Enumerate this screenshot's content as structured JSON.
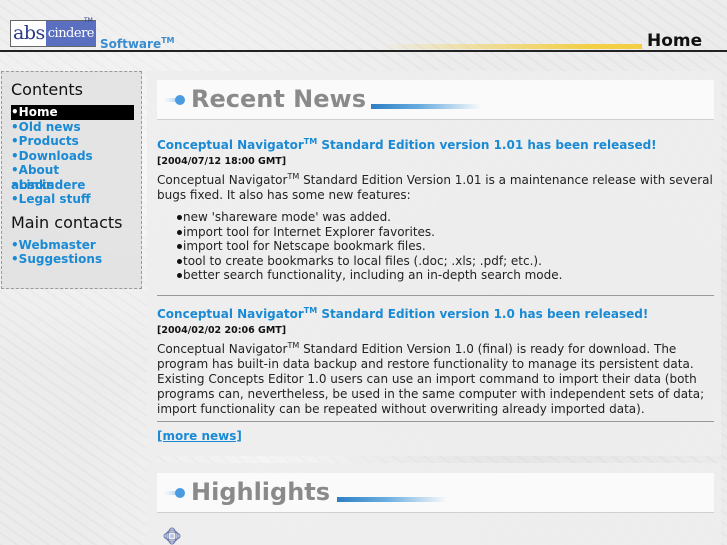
{
  "header": {
    "logo_abs": "abs",
    "logo_cindere": "cindere",
    "logo_tm": "TM",
    "software": "Software",
    "software_tm": "TM",
    "page_title": "Home"
  },
  "sidebar": {
    "contents_heading": "Contents",
    "items": [
      {
        "label": "•Home",
        "active": true
      },
      {
        "label": "•Old news"
      },
      {
        "label": "•Products"
      },
      {
        "label": "•Downloads"
      },
      {
        "label": "•About abscindere"
      },
      {
        "label": "•Links"
      },
      {
        "label": "•Legal stuff"
      }
    ],
    "contacts_heading": "Main contacts",
    "contacts": [
      {
        "label": "•Webmaster"
      },
      {
        "label": "•Suggestions"
      }
    ]
  },
  "recent_news": {
    "heading": "Recent News",
    "news": [
      {
        "title_pre": "Conceptual Navigator",
        "title_tm": "TM",
        "title_post": " Standard Edition version 1.01 has been released!",
        "date": "[2004/07/12 18:00 GMT]",
        "body_pre": "Conceptual Navigator",
        "body_tm": "TM",
        "body_post": " Standard Edition Version 1.01 is a maintenance release with several bugs fixed. It also has some new features:",
        "features": [
          "new 'shareware mode' was added.",
          "import tool for Internet Explorer favorites.",
          "import tool for Netscape bookmark files.",
          "tool to create bookmarks to local files (.doc; .xls; .pdf; etc.).",
          "better search functionality, including an in-depth search mode."
        ]
      },
      {
        "title_pre": "Conceptual Navigator",
        "title_tm": "TM",
        "title_post": " Standard Edition version 1.0 has been released!",
        "date": "[2004/02/02 20:06 GMT]",
        "body_pre": "Conceptual Navigator",
        "body_tm": "TM",
        "body_post": " Standard Edition Version 1.0 (final) is ready for download. The program has built-in data backup and restore functionality to manage its persistent data. Existing Concepts Editor 1.0 users can use an import command to import their data (both programs can, nevertheless, be used in the same computer with independent sets of data; import functionality can be repeated without overwriting already imported data)."
      }
    ],
    "more_link": "[more news]"
  },
  "highlights": {
    "heading": "Highlights"
  },
  "colors": {
    "link": "#1a8ad4",
    "heading_grey": "#8a8a8a",
    "accent_gold": "#f2cf45",
    "accent_blue": "#2d7fc4"
  }
}
